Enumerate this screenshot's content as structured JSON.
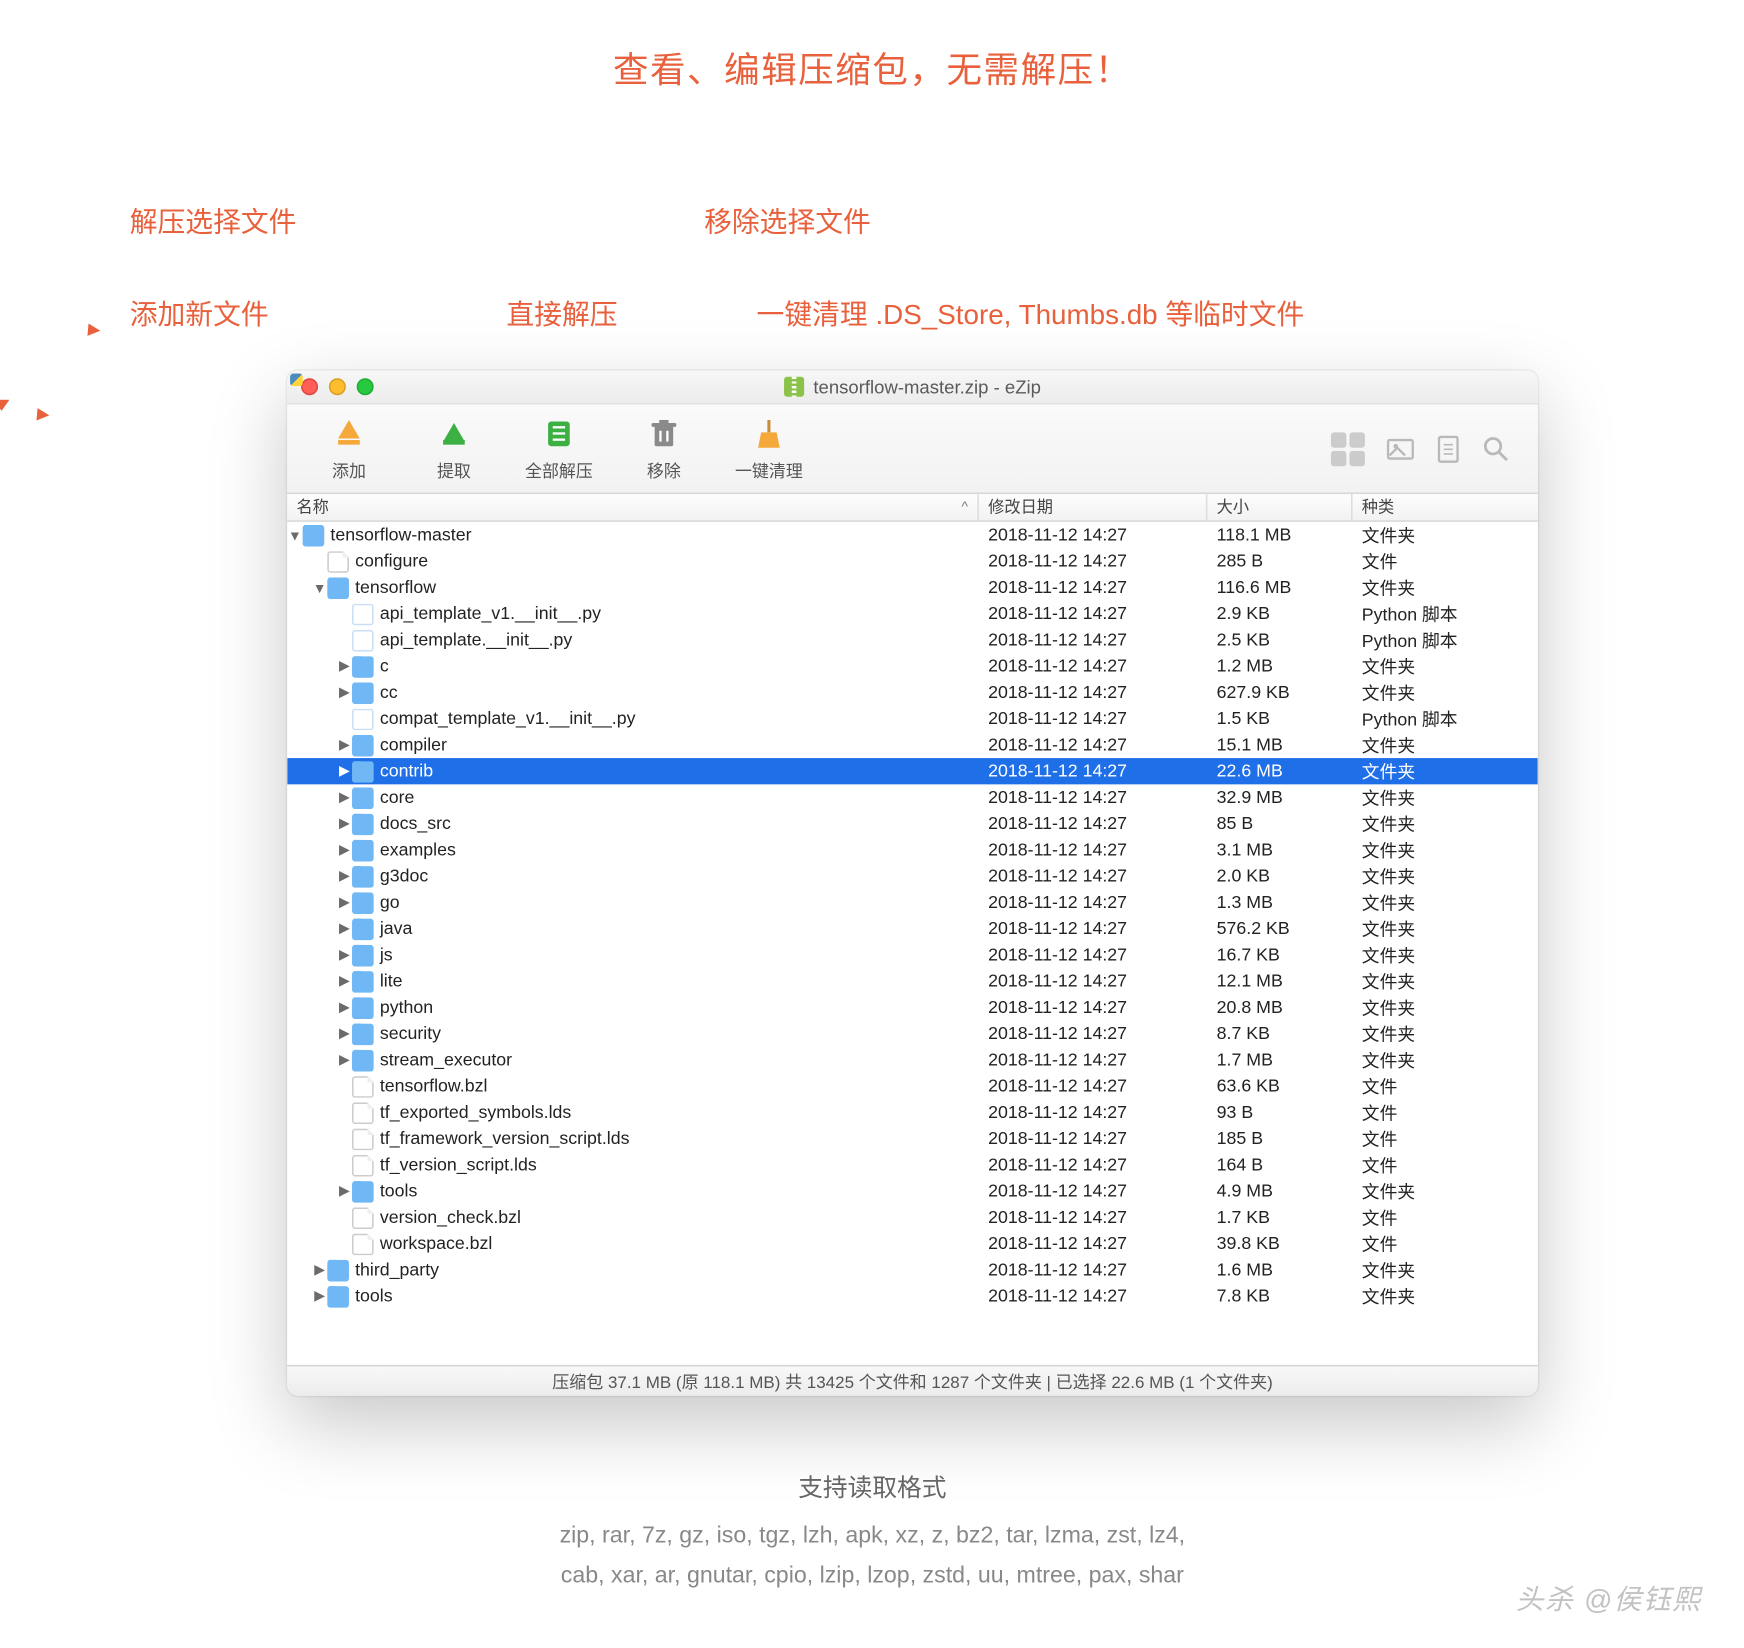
{
  "hero": "查看、编辑压缩包，无需解压！",
  "callouts": {
    "extract_sel": "解压选择文件",
    "add_new": "添加新文件",
    "direct_extract": "直接解压",
    "remove_sel": "移除选择文件",
    "cleanup": "一键清理 .DS_Store, Thumbs.db 等临时文件"
  },
  "window": {
    "title": "tensorflow-master.zip - eZip"
  },
  "toolbar": {
    "add": "添加",
    "extract": "提取",
    "extract_all": "全部解压",
    "remove": "移除",
    "cleanup": "一键清理"
  },
  "columns": {
    "name": "名称",
    "modified": "修改日期",
    "size": "大小",
    "kind": "种类"
  },
  "rows": [
    {
      "depth": 0,
      "tri": "down",
      "icon": "folder",
      "name": "tensorflow-master",
      "date": "2018-11-12 14:27",
      "size": "118.1 MB",
      "kind": "文件夹",
      "sel": false
    },
    {
      "depth": 1,
      "tri": "",
      "icon": "file",
      "name": "configure",
      "date": "2018-11-12 14:27",
      "size": "285 B",
      "kind": "文件",
      "sel": false
    },
    {
      "depth": 1,
      "tri": "down",
      "icon": "folder",
      "name": "tensorflow",
      "date": "2018-11-12 14:27",
      "size": "116.6 MB",
      "kind": "文件夹",
      "sel": false
    },
    {
      "depth": 2,
      "tri": "",
      "icon": "py",
      "name": "api_template_v1.__init__.py",
      "date": "2018-11-12 14:27",
      "size": "2.9 KB",
      "kind": "Python 脚本",
      "sel": false
    },
    {
      "depth": 2,
      "tri": "",
      "icon": "py",
      "name": "api_template.__init__.py",
      "date": "2018-11-12 14:27",
      "size": "2.5 KB",
      "kind": "Python 脚本",
      "sel": false
    },
    {
      "depth": 2,
      "tri": "right",
      "icon": "folder",
      "name": "c",
      "date": "2018-11-12 14:27",
      "size": "1.2 MB",
      "kind": "文件夹",
      "sel": false
    },
    {
      "depth": 2,
      "tri": "right",
      "icon": "folder",
      "name": "cc",
      "date": "2018-11-12 14:27",
      "size": "627.9 KB",
      "kind": "文件夹",
      "sel": false
    },
    {
      "depth": 2,
      "tri": "",
      "icon": "py",
      "name": "compat_template_v1.__init__.py",
      "date": "2018-11-12 14:27",
      "size": "1.5 KB",
      "kind": "Python 脚本",
      "sel": false
    },
    {
      "depth": 2,
      "tri": "right",
      "icon": "folder",
      "name": "compiler",
      "date": "2018-11-12 14:27",
      "size": "15.1 MB",
      "kind": "文件夹",
      "sel": false
    },
    {
      "depth": 2,
      "tri": "right",
      "icon": "folder",
      "name": "contrib",
      "date": "2018-11-12 14:27",
      "size": "22.6 MB",
      "kind": "文件夹",
      "sel": true
    },
    {
      "depth": 2,
      "tri": "right",
      "icon": "folder",
      "name": "core",
      "date": "2018-11-12 14:27",
      "size": "32.9 MB",
      "kind": "文件夹",
      "sel": false
    },
    {
      "depth": 2,
      "tri": "right",
      "icon": "folder",
      "name": "docs_src",
      "date": "2018-11-12 14:27",
      "size": "85 B",
      "kind": "文件夹",
      "sel": false
    },
    {
      "depth": 2,
      "tri": "right",
      "icon": "folder",
      "name": "examples",
      "date": "2018-11-12 14:27",
      "size": "3.1 MB",
      "kind": "文件夹",
      "sel": false
    },
    {
      "depth": 2,
      "tri": "right",
      "icon": "folder",
      "name": "g3doc",
      "date": "2018-11-12 14:27",
      "size": "2.0 KB",
      "kind": "文件夹",
      "sel": false
    },
    {
      "depth": 2,
      "tri": "right",
      "icon": "folder",
      "name": "go",
      "date": "2018-11-12 14:27",
      "size": "1.3 MB",
      "kind": "文件夹",
      "sel": false
    },
    {
      "depth": 2,
      "tri": "right",
      "icon": "folder",
      "name": "java",
      "date": "2018-11-12 14:27",
      "size": "576.2 KB",
      "kind": "文件夹",
      "sel": false
    },
    {
      "depth": 2,
      "tri": "right",
      "icon": "folder",
      "name": "js",
      "date": "2018-11-12 14:27",
      "size": "16.7 KB",
      "kind": "文件夹",
      "sel": false
    },
    {
      "depth": 2,
      "tri": "right",
      "icon": "folder",
      "name": "lite",
      "date": "2018-11-12 14:27",
      "size": "12.1 MB",
      "kind": "文件夹",
      "sel": false
    },
    {
      "depth": 2,
      "tri": "right",
      "icon": "folder",
      "name": "python",
      "date": "2018-11-12 14:27",
      "size": "20.8 MB",
      "kind": "文件夹",
      "sel": false
    },
    {
      "depth": 2,
      "tri": "right",
      "icon": "folder",
      "name": "security",
      "date": "2018-11-12 14:27",
      "size": "8.7 KB",
      "kind": "文件夹",
      "sel": false
    },
    {
      "depth": 2,
      "tri": "right",
      "icon": "folder",
      "name": "stream_executor",
      "date": "2018-11-12 14:27",
      "size": "1.7 MB",
      "kind": "文件夹",
      "sel": false
    },
    {
      "depth": 2,
      "tri": "",
      "icon": "file",
      "name": "tensorflow.bzl",
      "date": "2018-11-12 14:27",
      "size": "63.6 KB",
      "kind": "文件",
      "sel": false
    },
    {
      "depth": 2,
      "tri": "",
      "icon": "file",
      "name": "tf_exported_symbols.lds",
      "date": "2018-11-12 14:27",
      "size": "93 B",
      "kind": "文件",
      "sel": false
    },
    {
      "depth": 2,
      "tri": "",
      "icon": "file",
      "name": "tf_framework_version_script.lds",
      "date": "2018-11-12 14:27",
      "size": "185 B",
      "kind": "文件",
      "sel": false
    },
    {
      "depth": 2,
      "tri": "",
      "icon": "file",
      "name": "tf_version_script.lds",
      "date": "2018-11-12 14:27",
      "size": "164 B",
      "kind": "文件",
      "sel": false
    },
    {
      "depth": 2,
      "tri": "right",
      "icon": "folder",
      "name": "tools",
      "date": "2018-11-12 14:27",
      "size": "4.9 MB",
      "kind": "文件夹",
      "sel": false
    },
    {
      "depth": 2,
      "tri": "",
      "icon": "file",
      "name": "version_check.bzl",
      "date": "2018-11-12 14:27",
      "size": "1.7 KB",
      "kind": "文件",
      "sel": false
    },
    {
      "depth": 2,
      "tri": "",
      "icon": "file",
      "name": "workspace.bzl",
      "date": "2018-11-12 14:27",
      "size": "39.8 KB",
      "kind": "文件",
      "sel": false
    },
    {
      "depth": 1,
      "tri": "right",
      "icon": "folder",
      "name": "third_party",
      "date": "2018-11-12 14:27",
      "size": "1.6 MB",
      "kind": "文件夹",
      "sel": false
    },
    {
      "depth": 1,
      "tri": "right",
      "icon": "folder",
      "name": "tools",
      "date": "2018-11-12 14:27",
      "size": "7.8 KB",
      "kind": "文件夹",
      "sel": false
    }
  ],
  "statusbar": "压缩包 37.1 MB (原 118.1 MB) 共 13425 个文件和 1287 个文件夹  |  已选择 22.6 MB (1 个文件夹)",
  "footer": {
    "heading": "支持读取格式",
    "line1": "zip, rar, 7z, gz, iso, tgz, lzh, apk, xz, z, bz2, tar, lzma, zst, lz4,",
    "line2": "cab, xar, ar, gnutar, cpio, lzip, lzop, zstd, uu, mtree, pax, shar"
  },
  "credit": "头杀 @侯钰熙"
}
